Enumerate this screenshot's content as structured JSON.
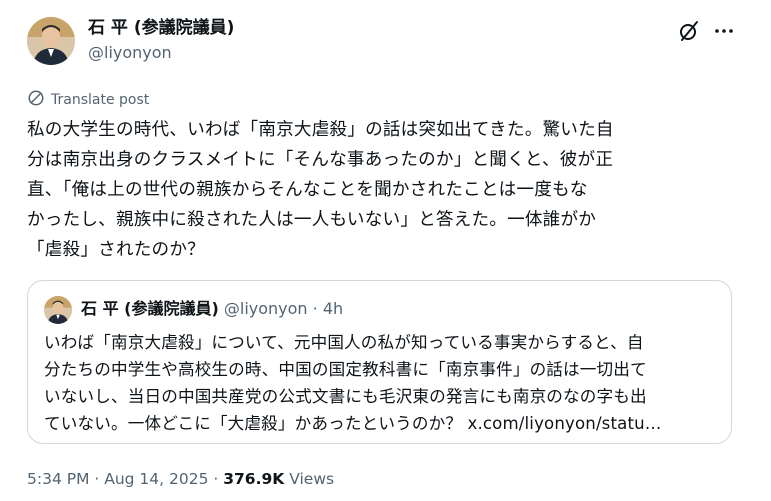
{
  "author": {
    "name": "石 平 (参議院議員)",
    "handle": "@liyonyon"
  },
  "icons": {
    "grok": "grok-icon",
    "more": "more-icon",
    "translate": "globe-translate-icon"
  },
  "translate_label": "Translate post",
  "post_text": "私の大学生の時代、いわば「南京大虐殺」の話は突如出てきた。驚いた自\n分は南京出身のクラスメイトに「そんな事あったのか」と聞くと、彼が正\n直、「俺は上の世代の親族からそんなことを聞かされたことは一度もな\nかったし、親族中に殺された人は一人もいない」と答えた。一体誰がか\n「虐殺」されたのか？",
  "quote": {
    "name": "石 平 (参議院議員)",
    "handle": "@liyonyon",
    "time": "4h",
    "text": "いわば「南京大虐殺」について、元中国人の私が知っている事実からすると、自\n分たちの中学生や高校生の時、中国の国定教科書に「南京事件」の話は一切出て\nいないし、当日の中国共産党の公式文書にも毛沢東の発言にも南京のなの字も出\nていない。一体どこに「大虐殺」かあったというのか？ x.com/liyonyon/statu…"
  },
  "meta": {
    "timestamp": "5:34 PM · Aug 14, 2025 · ",
    "views_count": "376.9K",
    "views_label": " Views"
  },
  "colors": {
    "text": "#0f1419",
    "secondary": "#536471",
    "border": "#cfd9de"
  }
}
